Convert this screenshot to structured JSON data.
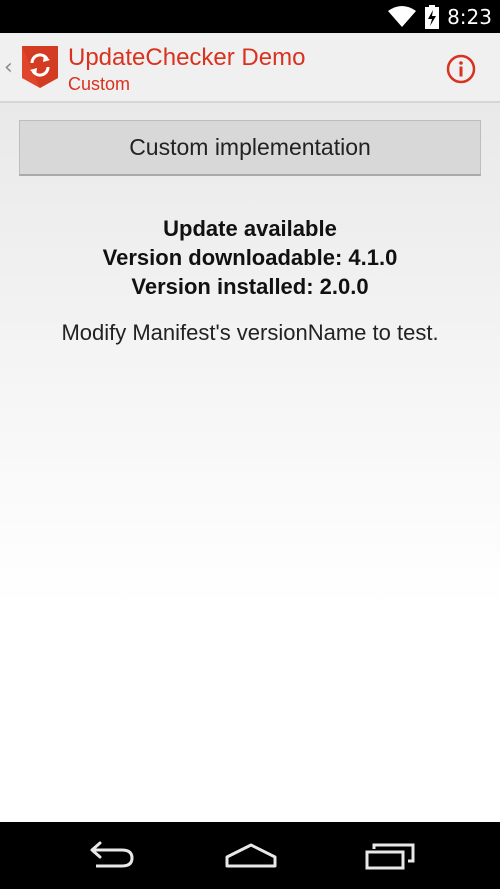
{
  "status_bar": {
    "time": "8:23",
    "icons": [
      "wifi-icon",
      "battery-charging-icon"
    ]
  },
  "action_bar": {
    "up_chevron": "‹",
    "title": "UpdateChecker Demo",
    "subtitle": "Custom",
    "icons": [
      "app-logo-icon",
      "info-icon"
    ],
    "accent_color": "#d9321f"
  },
  "content": {
    "button_label": "Custom implementation",
    "status_lines": [
      "Update available",
      "Version downloadable: 4.1.0",
      "Version installed: 2.0.0"
    ],
    "hint": "Modify Manifest's versionName to test."
  },
  "nav_bar": {
    "icons": [
      "back-icon",
      "home-icon",
      "recent-apps-icon"
    ]
  }
}
